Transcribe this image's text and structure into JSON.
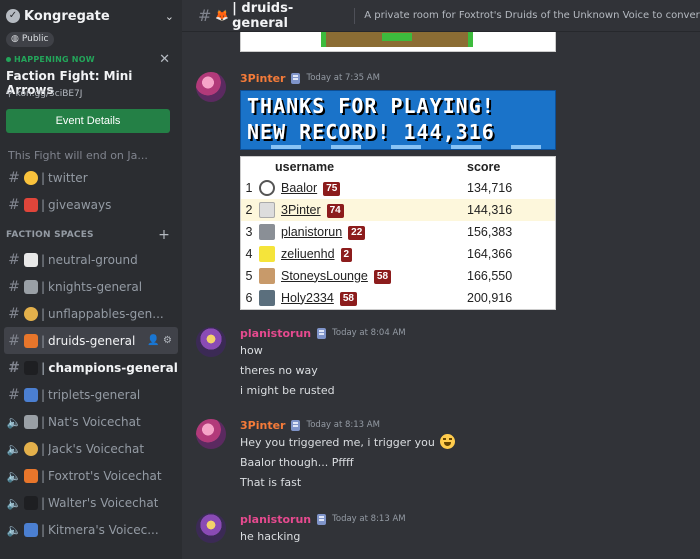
{
  "server": {
    "name": "Kongregate",
    "visibility": "Public"
  },
  "event": {
    "status": "HAPPENING NOW",
    "title": "Faction Fight: Mini Arrows",
    "link": "kon.gg/3ciBE7J",
    "button_label": "Event Details"
  },
  "sidebar": {
    "partial_item": "This Fight will end on Ja...",
    "top_channels": [
      {
        "icon": "pinch-emoji",
        "name": "twitter"
      },
      {
        "icon": "gift-emoji",
        "name": "giveaways"
      }
    ],
    "section_title": "FACTION SPACES",
    "channels": [
      {
        "icon": "flag-emoji",
        "name": "neutral-ground",
        "type": "text"
      },
      {
        "icon": "castle-emoji",
        "name": "knights-general",
        "type": "text"
      },
      {
        "icon": "pancake-emoji",
        "name": "unflappables-gen...",
        "type": "text"
      },
      {
        "icon": "fox-emoji",
        "name": "druids-general",
        "type": "text",
        "active": true
      },
      {
        "icon": "sword-emoji",
        "name": "champions-general",
        "type": "text",
        "unread": true
      },
      {
        "icon": "triangle-ruler-emoji",
        "name": "triplets-general",
        "type": "text"
      },
      {
        "icon": "castle-emoji",
        "name": "Nat's Voicechat",
        "type": "voice"
      },
      {
        "icon": "pancake-emoji",
        "name": "Jack's Voicechat",
        "type": "voice"
      },
      {
        "icon": "fox-emoji",
        "name": "Foxtrot's Voicechat",
        "type": "voice"
      },
      {
        "icon": "sword-emoji",
        "name": "Walter's Voicechat",
        "type": "voice"
      },
      {
        "icon": "triangle-ruler-emoji",
        "name": "Kitmera's Voicec...",
        "type": "voice"
      }
    ]
  },
  "channel_header": {
    "emoji": "fox-emoji",
    "name": "| druids-general",
    "topic": "A private room for Foxtrot's Druids of the Unknown Voice to converse."
  },
  "banner": {
    "line1": "THANKS FOR PLAYING!",
    "line2": "NEW RECORD! 144,316"
  },
  "leaderboard": {
    "headers": {
      "username": "username",
      "score": "score"
    },
    "rows": [
      {
        "rank": "1",
        "name": "Baalor",
        "level": "75",
        "score": "134,716"
      },
      {
        "rank": "2",
        "name": "3Pinter",
        "level": "74",
        "score": "144,316",
        "highlight": true
      },
      {
        "rank": "3",
        "name": "planistorun",
        "level": "22",
        "score": "156,383"
      },
      {
        "rank": "4",
        "name": "zeliuenhd",
        "level": "2",
        "score": "164,366"
      },
      {
        "rank": "5",
        "name": "StoneysLounge",
        "level": "58",
        "score": "166,550"
      },
      {
        "rank": "6",
        "name": "Holy2334",
        "level": "58",
        "score": "200,916"
      }
    ]
  },
  "messages": [
    {
      "author": "3Pinter",
      "timestamp": "Today at 7:35 AM",
      "lines": []
    },
    {
      "author": "planistorun",
      "timestamp": "Today at 8:04 AM",
      "lines": [
        "how",
        "theres no way",
        "i might be rusted"
      ]
    },
    {
      "author": "3Pinter",
      "timestamp": "Today at 8:13 AM",
      "lines": [
        "Hey you triggered me, i trigger you",
        "Baalor though... Pffff",
        "That is fast"
      ]
    },
    {
      "author": "planistorun",
      "timestamp": "Today at 8:13 AM",
      "lines": [
        "he hacking"
      ]
    }
  ],
  "colors": {
    "sidebar_bg": "#2b2d31",
    "chat_bg": "#313338",
    "event_button": "#248046",
    "author_3pinter": "#f57b39",
    "author_planistorun": "#e64a8f",
    "banner_bg": "#1a73c9",
    "level_badge": "#8c1c1c"
  }
}
